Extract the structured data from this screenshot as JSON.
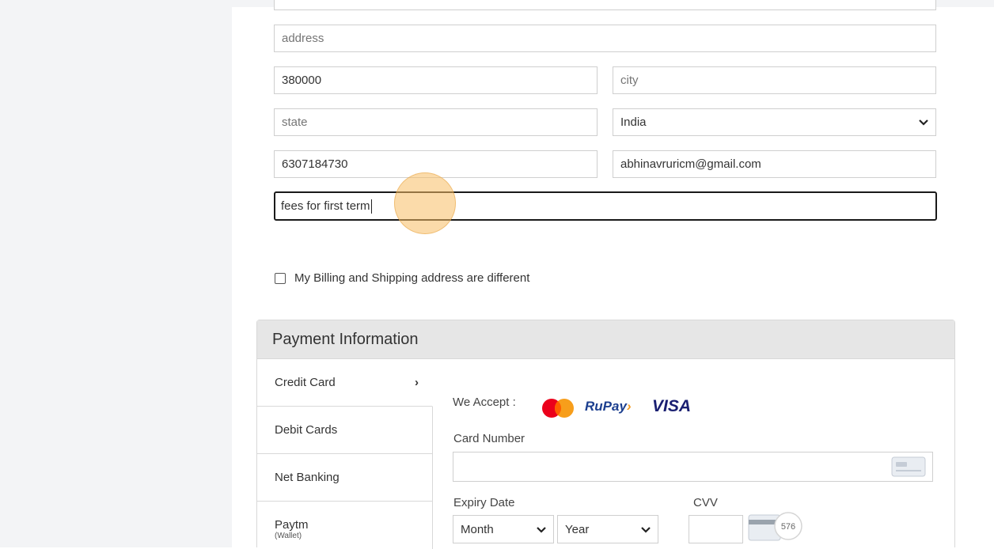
{
  "form": {
    "address_placeholder": "address",
    "pincode_value": "380000",
    "city_placeholder": "city",
    "state_placeholder": "state",
    "country_selected": "India",
    "phone_value": "6307184730",
    "email_value": "abhinavruricm@gmail.com",
    "notes_value": "fees for first term"
  },
  "billing_checkbox_label": "My Billing and Shipping address are different",
  "payment": {
    "header": "Payment Information",
    "tabs": [
      {
        "label": "Credit Card",
        "sub": ""
      },
      {
        "label": "Debit Cards",
        "sub": ""
      },
      {
        "label": "Net Banking",
        "sub": ""
      },
      {
        "label": "Paytm",
        "sub": "(Wallet)"
      }
    ],
    "we_accept_label": "We Accept :",
    "logos": {
      "mastercard": "MasterCard",
      "rupay": "RuPay",
      "visa": "VISA"
    },
    "card_number_label": "Card Number",
    "expiry_label": "Expiry Date",
    "month_placeholder": "Month",
    "year_placeholder": "Year",
    "cvv_label": "CVV",
    "cvv_hint_text": "576"
  },
  "colors": {
    "page_bg": "#f3f4f6",
    "panel_header_bg": "#e6e6e6",
    "rupay_blue": "#1c3f8f",
    "rupay_orange": "#f39a1e",
    "visa_blue": "#1a1f71",
    "click_highlight": "#f7be64"
  }
}
